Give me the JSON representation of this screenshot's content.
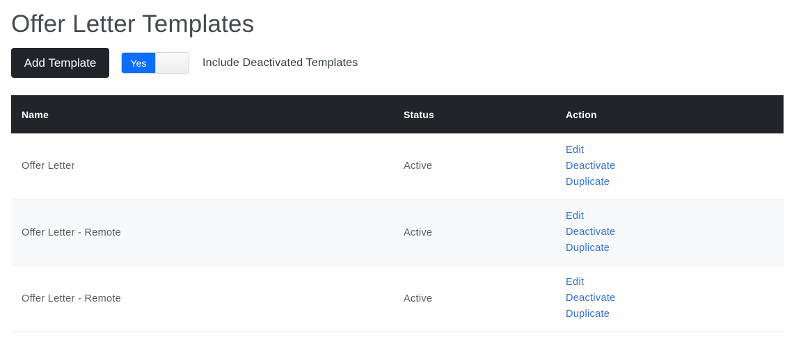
{
  "page": {
    "title": "Offer Letter Templates"
  },
  "toolbar": {
    "add_label": "Add Template",
    "toggle_state": "Yes",
    "toggle_label": "Include Deactivated Templates"
  },
  "table": {
    "headers": {
      "name": "Name",
      "status": "Status",
      "action": "Action"
    },
    "rows": [
      {
        "name": "Offer Letter",
        "status": "Active",
        "actions": [
          "Edit",
          "Deactivate",
          "Duplicate"
        ]
      },
      {
        "name": "Offer Letter - Remote",
        "status": "Active",
        "actions": [
          "Edit",
          "Deactivate",
          "Duplicate"
        ]
      },
      {
        "name": "Offer Letter - Remote",
        "status": "Active",
        "actions": [
          "Edit",
          "Deactivate",
          "Duplicate"
        ]
      }
    ]
  },
  "colors": {
    "header_bg": "#212529",
    "toggle_on": "#0d6efd",
    "link": "#2f6fd6"
  }
}
